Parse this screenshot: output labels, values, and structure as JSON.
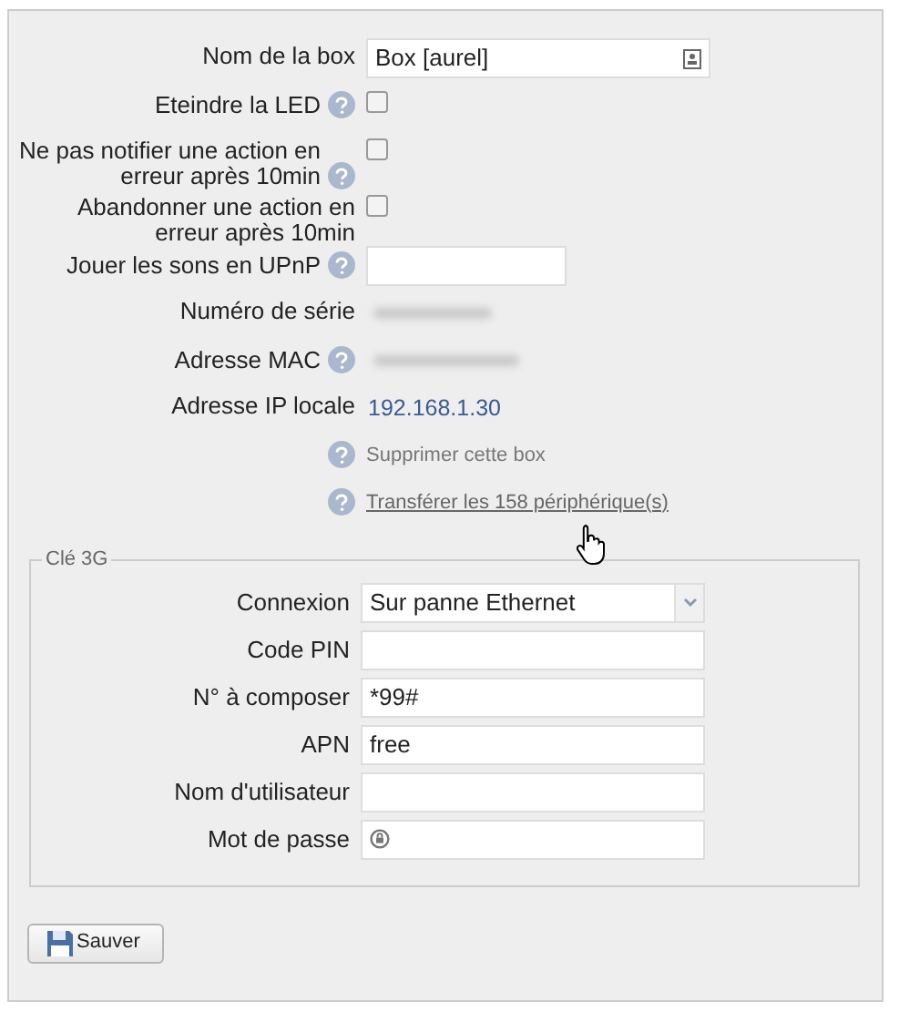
{
  "settings": [
    {
      "kind": "name",
      "label": "Nom de la box",
      "value": "Box [aurel]",
      "help": false
    },
    {
      "kind": "checkbox",
      "label": "Eteindre la LED",
      "help": true,
      "checked": false
    },
    {
      "kind": "checkbox",
      "label": "Ne pas notifier une action en erreur après 10min",
      "help": true,
      "checked": false
    },
    {
      "kind": "checkbox",
      "label": "Abandonner une action en erreur après 10min",
      "help": false,
      "checked": false
    },
    {
      "kind": "short_text",
      "label": "Jouer les sons en UPnP",
      "help": true
    },
    {
      "kind": "redacted",
      "label": "Numéro de série",
      "help": false
    },
    {
      "kind": "redacted",
      "label": "Adresse MAC",
      "help": true
    },
    {
      "kind": "info",
      "label": "Adresse IP locale",
      "value": "192.168.1.30",
      "help": false
    },
    {
      "kind": "action",
      "text": "Supprimer cette box",
      "help": true
    },
    {
      "kind": "link",
      "text": "Transférer les 158 périphérique(s)",
      "help": true
    }
  ],
  "three_g": {
    "legend": "Clé 3G",
    "fields": [
      {
        "kind": "select",
        "label": "Connexion",
        "value": "Sur panne Ethernet"
      },
      {
        "kind": "text",
        "label": "Code PIN"
      },
      {
        "kind": "text",
        "label": "N° à composer",
        "value": "*99#"
      },
      {
        "kind": "text",
        "label": "APN",
        "value": "free"
      },
      {
        "kind": "text",
        "label": "Nom d'utilisateur"
      },
      {
        "kind": "password",
        "label": "Mot de passe"
      }
    ]
  },
  "save_button": "Sauver"
}
